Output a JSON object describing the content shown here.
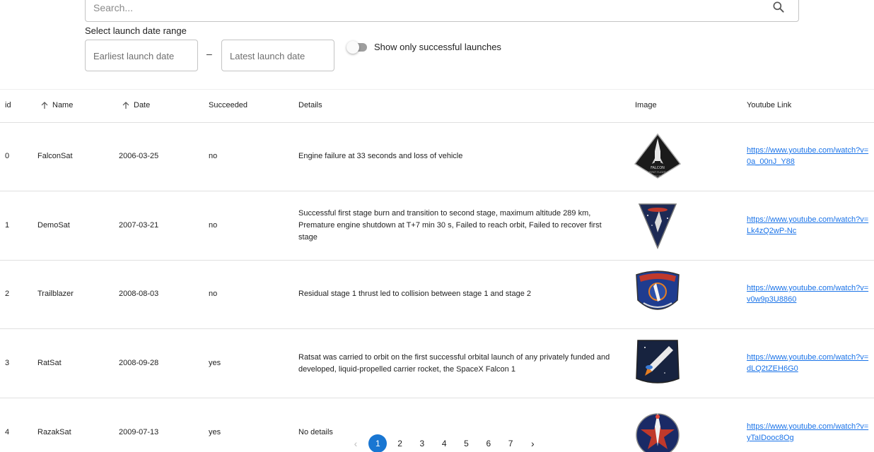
{
  "search": {
    "placeholder": "Search..."
  },
  "filters": {
    "date_range_label": "Select launch date range",
    "earliest_placeholder": "Earliest launch date",
    "latest_placeholder": "Latest launch date",
    "separator": "–",
    "toggle_label": "Show only successful launches",
    "toggle_on": false
  },
  "table": {
    "headers": {
      "id": "id",
      "name": "Name",
      "date": "Date",
      "succeeded": "Succeeded",
      "details": "Details",
      "image": "Image",
      "youtube": "Youtube Link"
    },
    "rows": [
      {
        "id": "0",
        "name": "FalconSat",
        "date": "2006-03-25",
        "succeeded": "no",
        "details": "Engine failure at 33 seconds and loss of vehicle",
        "link": "https://www.youtube.com/watch?v=0a_00nJ_Y88"
      },
      {
        "id": "1",
        "name": "DemoSat",
        "date": "2007-03-21",
        "succeeded": "no",
        "details": "Successful first stage burn and transition to second stage, maximum altitude 289 km, Premature engine shutdown at T+7 min 30 s, Failed to reach orbit, Failed to recover first stage",
        "link": "https://www.youtube.com/watch?v=Lk4zQ2wP-Nc"
      },
      {
        "id": "2",
        "name": "Trailblazer",
        "date": "2008-08-03",
        "succeeded": "no",
        "details": "Residual stage 1 thrust led to collision between stage 1 and stage 2",
        "link": "https://www.youtube.com/watch?v=v0w9p3U8860"
      },
      {
        "id": "3",
        "name": "RatSat",
        "date": "2008-09-28",
        "succeeded": "yes",
        "details": "Ratsat was carried to orbit on the first successful orbital launch of any privately funded and developed, liquid-propelled carrier rocket, the SpaceX Falcon 1",
        "link": "https://www.youtube.com/watch?v=dLQ2tZEH6G0"
      },
      {
        "id": "4",
        "name": "RazakSat",
        "date": "2009-07-13",
        "succeeded": "yes",
        "details": "No details",
        "link": "https://www.youtube.com/watch?v=yTaIDooc8Og"
      }
    ]
  },
  "patch_text": {
    "falcon": "FALCON",
    "first_flight": "FIRST FLIGHT",
    "spacex": "SPACEX"
  },
  "pagination": {
    "prev": "‹",
    "next": "›",
    "pages": [
      "1",
      "2",
      "3",
      "4",
      "5",
      "6",
      "7"
    ],
    "current": "1"
  },
  "colors": {
    "accent": "#1976d2",
    "link": "#1a73e8"
  }
}
